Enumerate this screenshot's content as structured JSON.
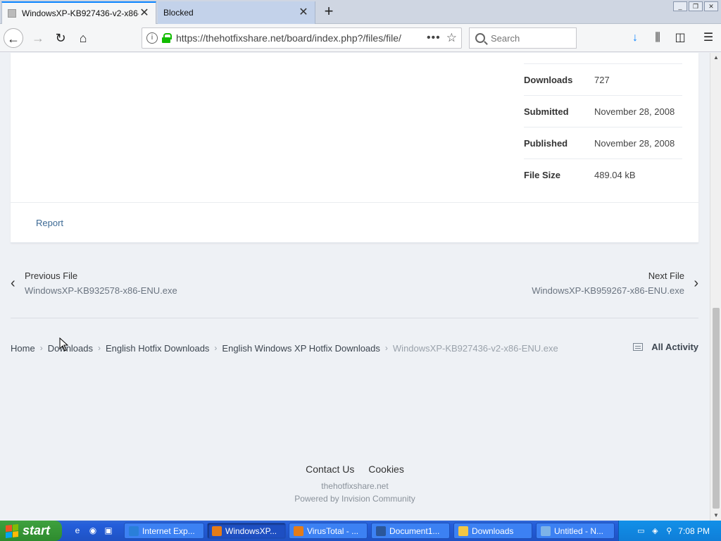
{
  "browser": {
    "tabs": [
      {
        "label": "WindowsXP-KB927436-v2-x86-ENU.exe",
        "close": "✕",
        "active": true
      },
      {
        "label": "Blocked",
        "close": "✕",
        "active": false
      }
    ],
    "new_tab": "+",
    "window_controls": [
      "_",
      "❐",
      "✕"
    ],
    "nav": {
      "back": "←",
      "forward": "→",
      "reload": "↻",
      "home": "⌂"
    },
    "url": "https://thehotfixshare.net/board/index.php?/files/file/",
    "page_actions": "•••",
    "bookmark": "☆",
    "search_placeholder": "Search",
    "toolbar_icons": {
      "download": "↓",
      "library": "⫼",
      "sidebar": "◫",
      "menu": "☰"
    }
  },
  "file_stats": [
    {
      "label": "Downloads",
      "value": "727"
    },
    {
      "label": "Submitted",
      "value": "November 28, 2008"
    },
    {
      "label": "Published",
      "value": "November 28, 2008"
    },
    {
      "label": "File Size",
      "value": "489.04 kB"
    }
  ],
  "report_link": "Report",
  "prev_file": {
    "title": "Previous File",
    "name": "WindowsXP-KB932578-x86-ENU.exe",
    "chevron": "‹"
  },
  "next_file": {
    "title": "Next File",
    "name": "WindowsXP-KB959267-x86-ENU.exe",
    "chevron": "›"
  },
  "breadcrumb": {
    "items": [
      "Home",
      "Downloads",
      "English Hotfix Downloads",
      "English Windows XP Hotfix Downloads"
    ],
    "current": "WindowsXP-KB927436-v2-x86-ENU.exe",
    "separator": "›"
  },
  "all_activity": "All Activity",
  "footer": {
    "links": [
      "Contact Us",
      "Cookies"
    ],
    "site": "thehotfixshare.net",
    "powered": "Powered by Invision Community"
  },
  "taskbar": {
    "start": "start",
    "tasks": [
      {
        "label": "Internet Exp...",
        "color": "#2a7fd9",
        "active": false
      },
      {
        "label": "WindowsXP...",
        "color": "#e57c18",
        "active": true
      },
      {
        "label": "VirusTotal - ...",
        "color": "#e57c18",
        "active": false
      },
      {
        "label": "Document1...",
        "color": "#2b579a",
        "active": false
      },
      {
        "label": "Downloads",
        "color": "#f2c744",
        "active": false
      },
      {
        "label": "Untitled - N...",
        "color": "#7db3e8",
        "active": false
      }
    ],
    "clock": "7:08 PM"
  }
}
